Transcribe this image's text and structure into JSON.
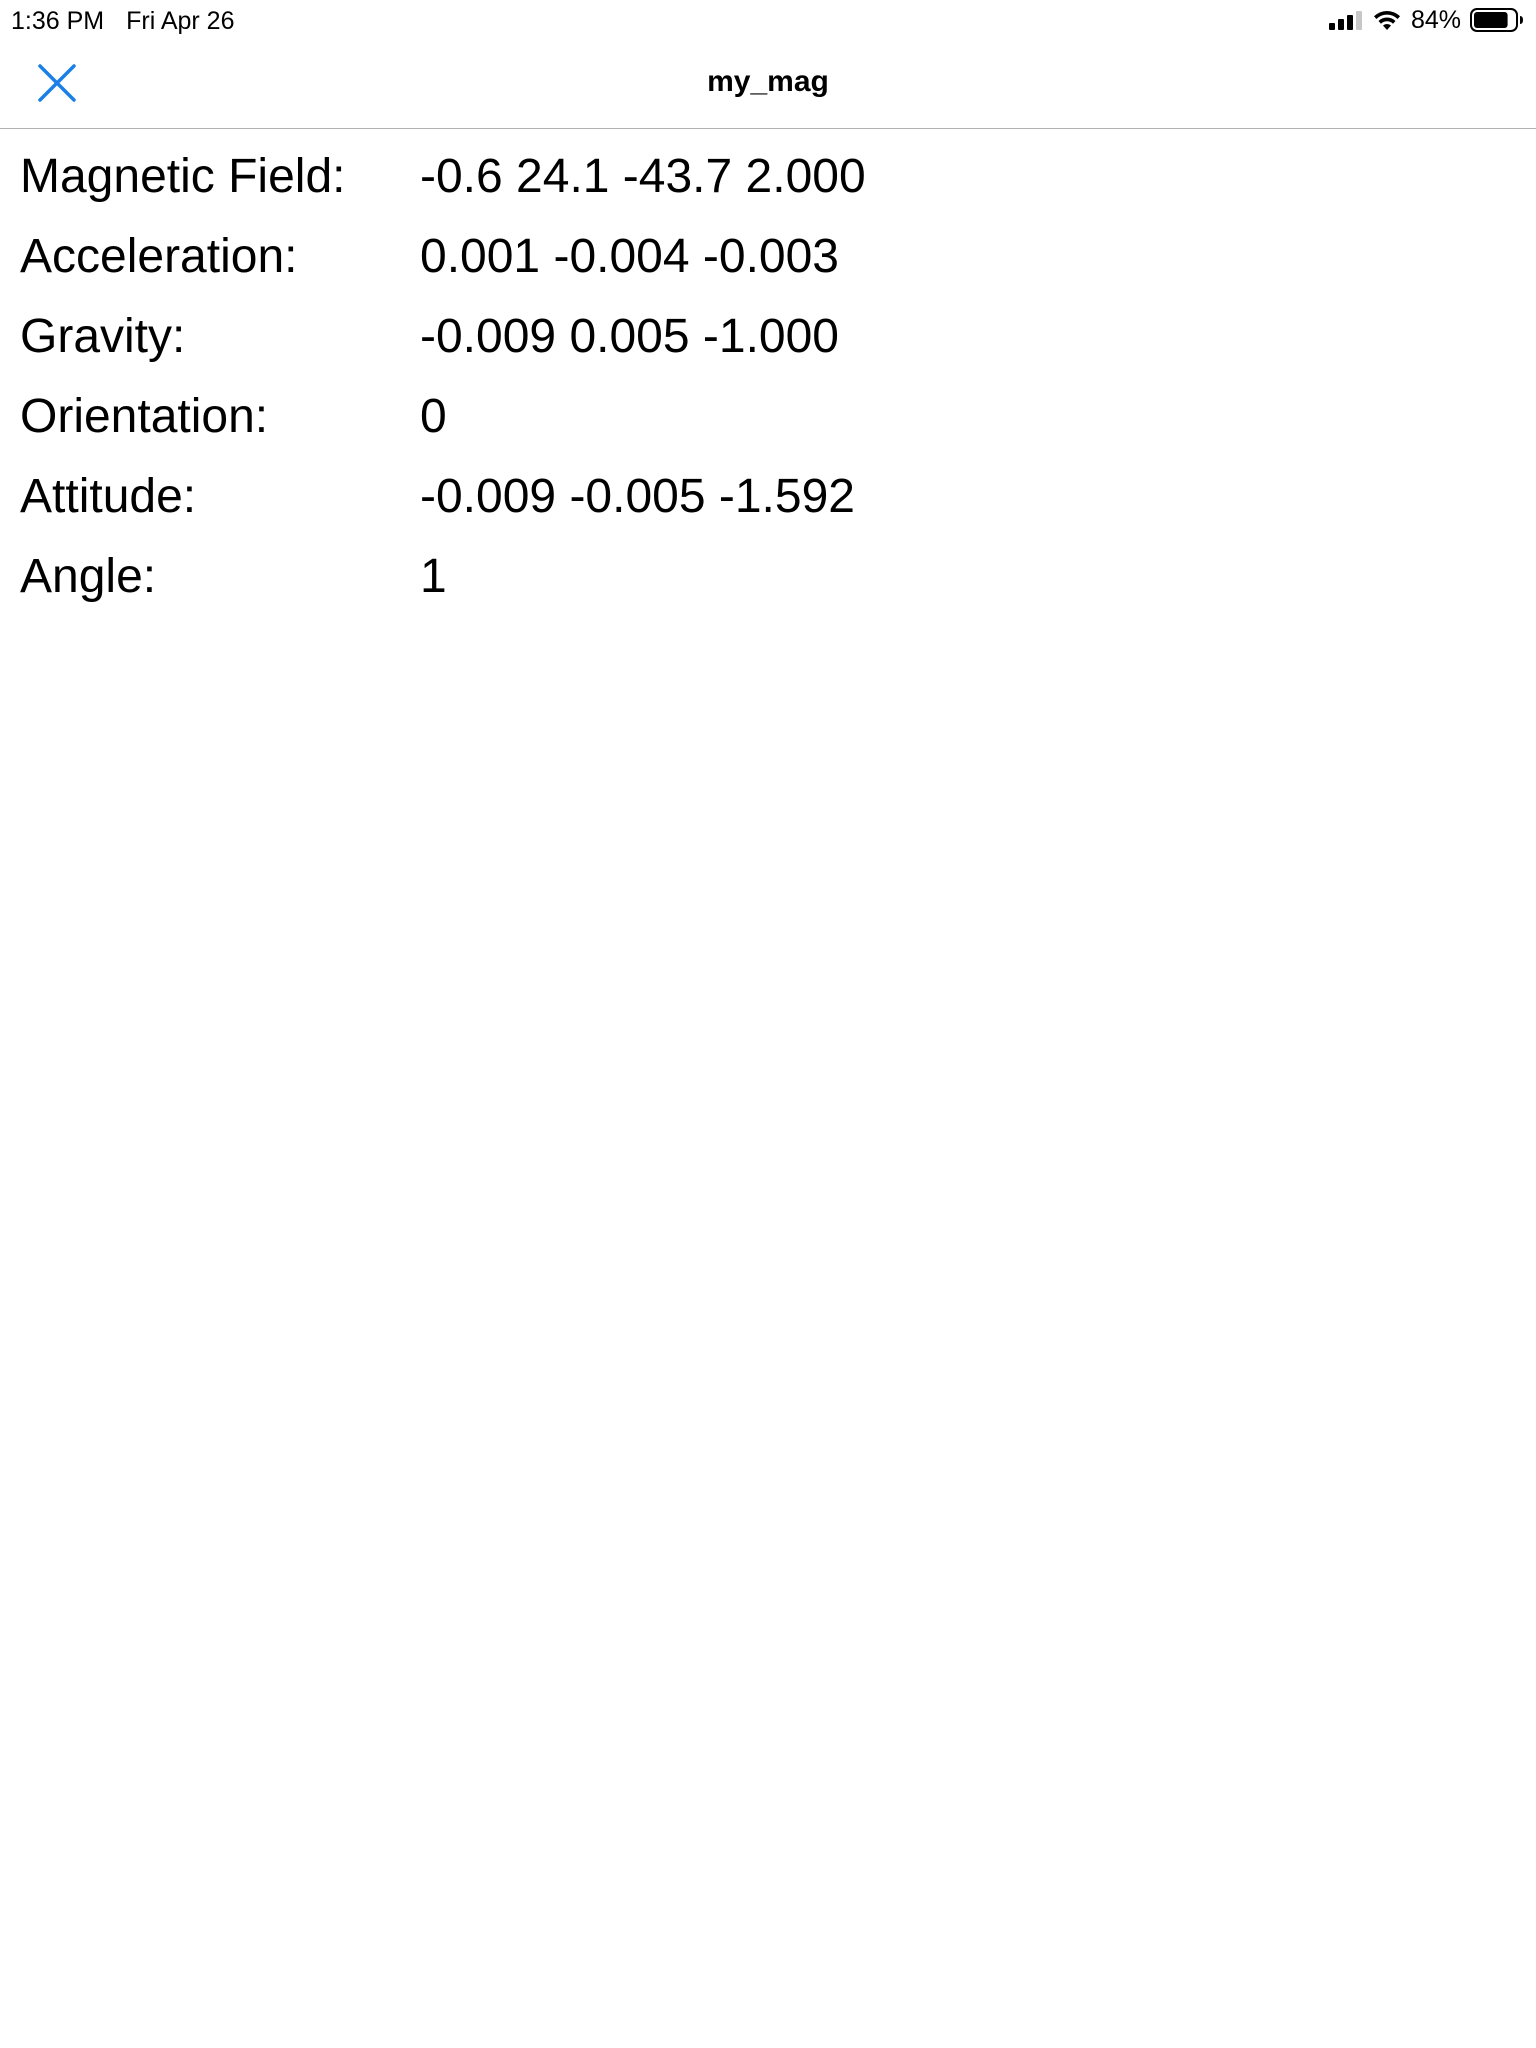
{
  "status_bar": {
    "time": "1:36 PM",
    "date": "Fri Apr 26",
    "battery_percent": "84%",
    "battery_level": 0.84,
    "icons": [
      "cellular-signal-icon",
      "wifi-icon",
      "battery-icon"
    ]
  },
  "nav": {
    "title": "my_mag",
    "close_icon": "close-icon",
    "accent_color": "#1a7fe6"
  },
  "readings": [
    {
      "label": "Magnetic Field:",
      "value": "-0.6 24.1 -43.7 2.000"
    },
    {
      "label": "Acceleration:",
      "value": "0.001 -0.004 -0.003"
    },
    {
      "label": "Gravity:",
      "value": "-0.009 0.005 -1.000"
    },
    {
      "label": "Orientation:",
      "value": "0"
    },
    {
      "label": "Attitude:",
      "value": "-0.009 -0.005 -1.592"
    },
    {
      "label": "Angle:",
      "value": "1"
    }
  ]
}
